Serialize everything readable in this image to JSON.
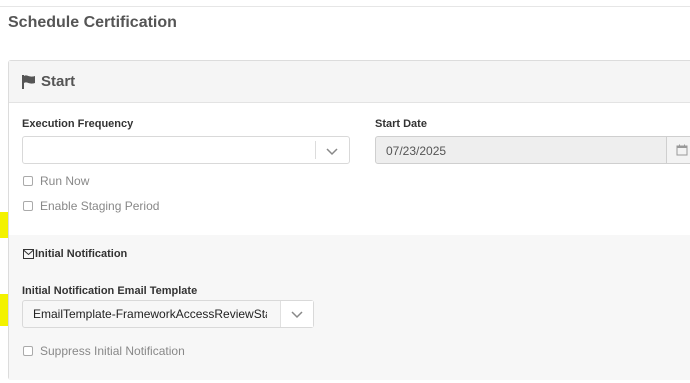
{
  "page": {
    "title": "Schedule Certification"
  },
  "panel": {
    "title": "Start"
  },
  "form": {
    "execution_frequency": {
      "label": "Execution Frequency",
      "value": ""
    },
    "start_date": {
      "label": "Start Date",
      "value": "07/23/2025"
    },
    "run_now": {
      "label": "Run Now",
      "checked": false
    },
    "enable_staging": {
      "label": "Enable Staging Period",
      "checked": false
    }
  },
  "notification": {
    "heading": "Initial Notification",
    "template_label": "Initial Notification Email Template",
    "template_value": "EmailTemplate-FrameworkAccessReviewSta",
    "suppress": {
      "label": "Suppress Initial Notification",
      "checked": false
    }
  },
  "colors": {
    "highlight": "#f3f200",
    "header_bg": "#f5f5f5",
    "section_bg": "#f7f7f7"
  }
}
